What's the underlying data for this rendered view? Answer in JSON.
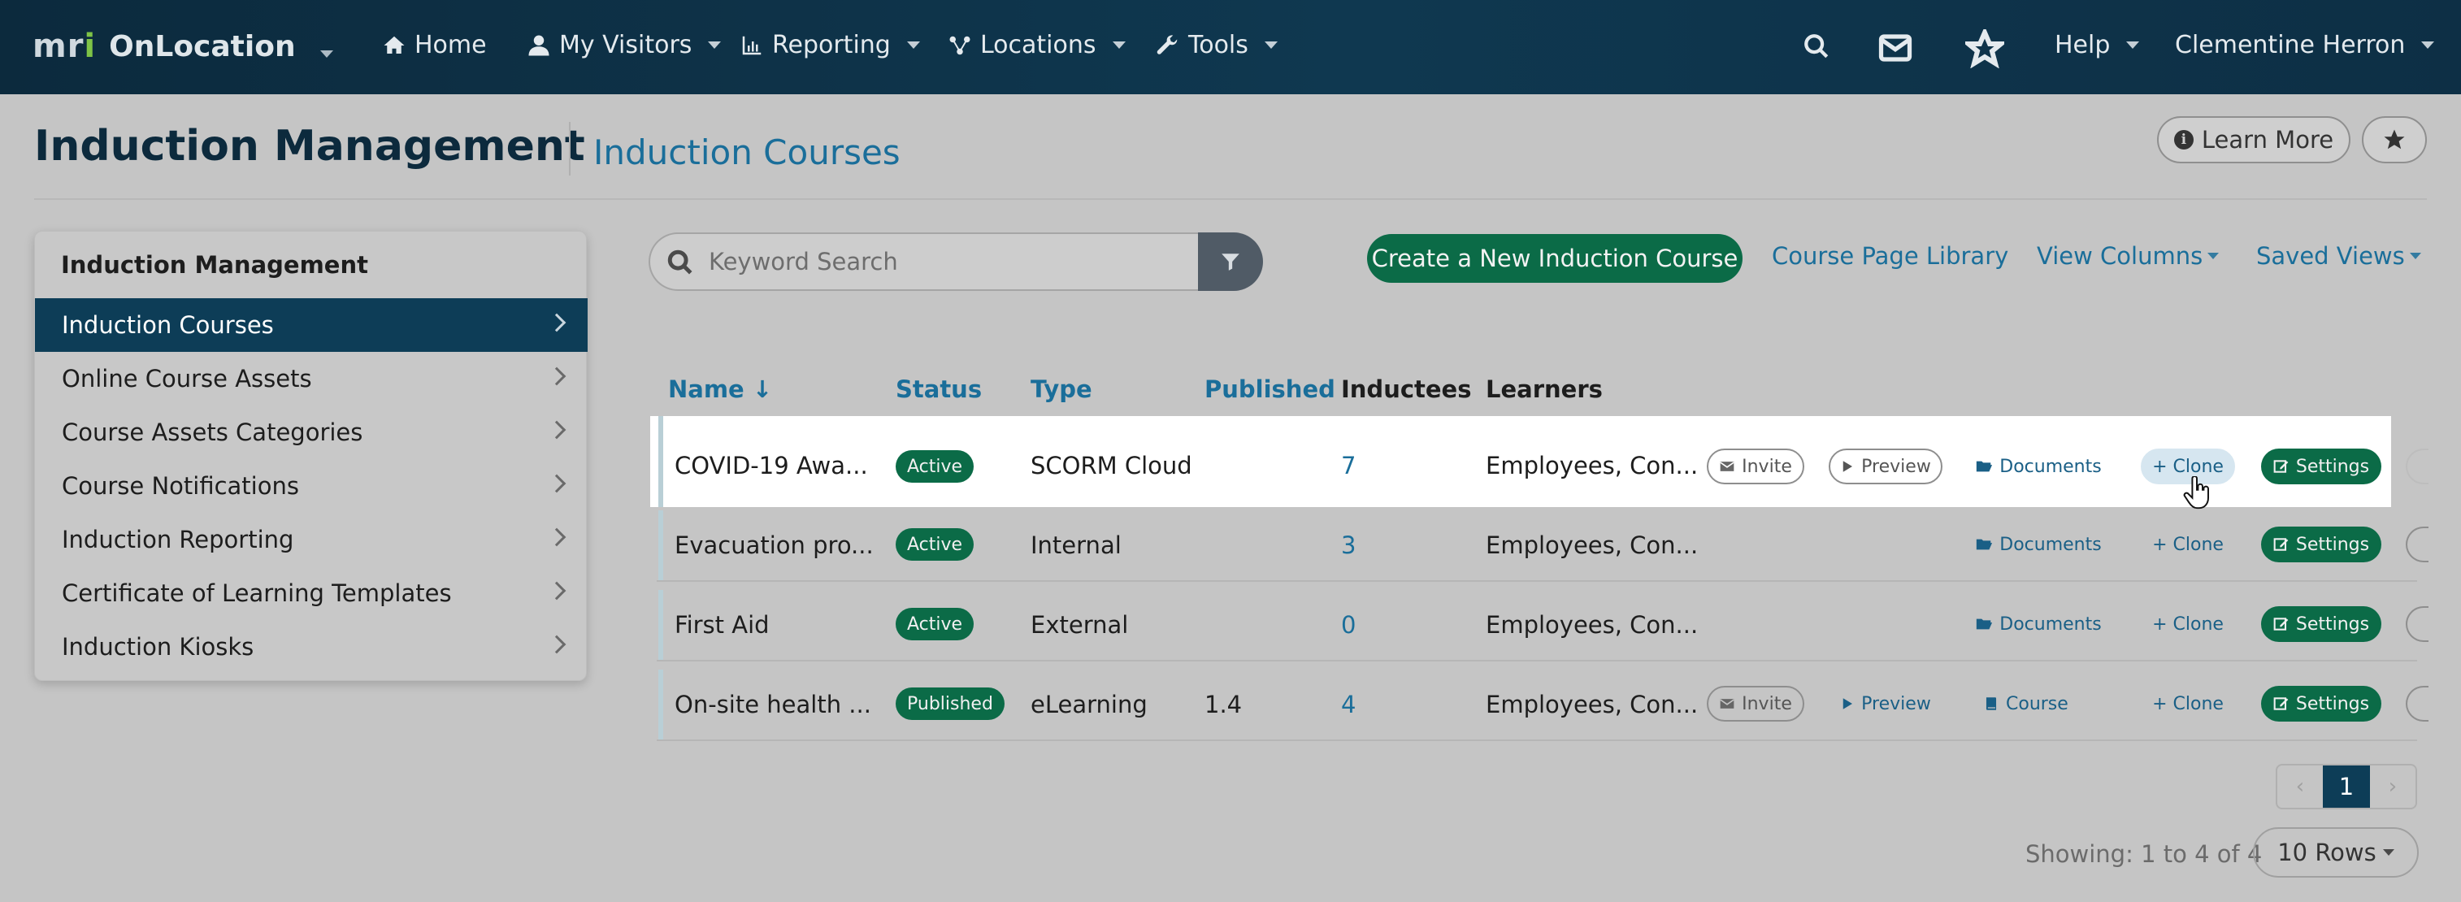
{
  "nav": {
    "logo_text": "OnLocation",
    "logo_mark": {
      "m": "m",
      "r": "r",
      "i": "i"
    },
    "items": [
      {
        "label": "Home",
        "icon": "home-icon"
      },
      {
        "label": "My Visitors",
        "icon": "user-icon"
      },
      {
        "label": "Reporting",
        "icon": "chart-icon"
      },
      {
        "label": "Locations",
        "icon": "network-icon"
      },
      {
        "label": "Tools",
        "icon": "wrench-icon"
      }
    ],
    "help_label": "Help",
    "user_name": "Clementine Herron"
  },
  "header": {
    "title": "Induction Management",
    "subtitle": "Induction Courses",
    "learn_more_label": "Learn More"
  },
  "sidebar": {
    "heading": "Induction Management",
    "items": [
      {
        "label": "Induction Courses",
        "active": true
      },
      {
        "label": "Online Course Assets"
      },
      {
        "label": "Course Assets Categories"
      },
      {
        "label": "Course Notifications"
      },
      {
        "label": "Induction Reporting"
      },
      {
        "label": "Certificate of Learning Templates"
      },
      {
        "label": "Induction Kiosks"
      }
    ]
  },
  "toolbar": {
    "search_placeholder": "Keyword Search",
    "create_label": "Create a New Induction Course",
    "library_label": "Course Page Library",
    "view_columns_label": "View Columns",
    "saved_views_label": "Saved Views"
  },
  "table": {
    "columns": {
      "name": "Name ↓",
      "status": "Status",
      "type": "Type",
      "published": "Published",
      "inductees": "Inductees",
      "learners": "Learners"
    },
    "actions": {
      "invite": "Invite",
      "preview": "Preview",
      "documents": "Documents",
      "course": "Course",
      "clone": "+ Clone",
      "settings": "Settings"
    },
    "rows": [
      {
        "name": "COVID-19 Awa...",
        "status": "Active",
        "type": "SCORM Cloud",
        "published": "",
        "inductees": "7",
        "learners": "Employees, Con..."
      },
      {
        "name": "Evacuation pro...",
        "status": "Active",
        "type": "Internal",
        "published": "",
        "inductees": "3",
        "learners": "Employees, Con..."
      },
      {
        "name": "First Aid",
        "status": "Active",
        "type": "External",
        "published": "",
        "inductees": "0",
        "learners": "Employees, Con..."
      },
      {
        "name": "On-site health ...",
        "status": "Published",
        "type": "eLearning",
        "published": "1.4",
        "inductees": "4",
        "learners": "Employees, Con..."
      }
    ]
  },
  "pagination": {
    "current_page": "1",
    "showing": "Showing: 1 to 4 of 4",
    "rows_label": "10 Rows"
  },
  "colors": {
    "nav_bg": "#0f3850",
    "accent_green": "#0b6b47",
    "link_blue": "#1a6e9a",
    "active_item": "#0d3d57"
  }
}
